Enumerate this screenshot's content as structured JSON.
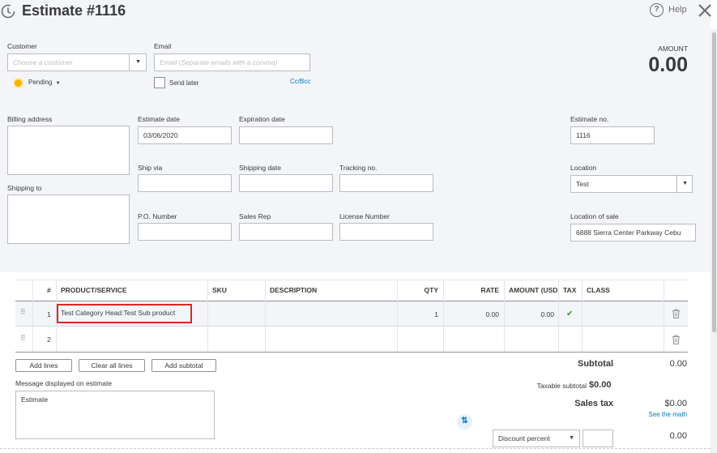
{
  "header": {
    "title": "Estimate #1116",
    "help": "Help"
  },
  "customer": {
    "label": "Customer",
    "placeholder": "Choose a customer"
  },
  "email": {
    "label": "Email",
    "placeholder": "Email (Separate emails with a comma)",
    "send_later": "Send later",
    "ccbcc": "Cc/Bcc"
  },
  "status": "Pending",
  "amount": {
    "label": "AMOUNT",
    "value": "0.00"
  },
  "billing_address": {
    "label": "Billing address"
  },
  "shipping_to": {
    "label": "Shipping to"
  },
  "estimate_date": {
    "label": "Estimate date",
    "value": "03/06/2020"
  },
  "expiration_date": {
    "label": "Expiration date"
  },
  "estimate_no": {
    "label": "Estimate no.",
    "value": "1116"
  },
  "ship_via": {
    "label": "Ship via"
  },
  "shipping_date": {
    "label": "Shipping date"
  },
  "tracking_no": {
    "label": "Tracking no."
  },
  "location": {
    "label": "Location",
    "value": "Test"
  },
  "po_number": {
    "label": "P.O. Number"
  },
  "sales_rep": {
    "label": "Sales Rep"
  },
  "license_number": {
    "label": "License Number"
  },
  "location_of_sale": {
    "label": "Location of sale",
    "value": "6888 Sierra Center Parkway Cebu"
  },
  "table": {
    "headers": {
      "num": "#",
      "product": "PRODUCT/SERVICE",
      "sku": "SKU",
      "description": "DESCRIPTION",
      "qty": "QTY",
      "rate": "RATE",
      "amount": "AMOUNT (USD",
      "tax": "TAX",
      "class": "CLASS"
    },
    "rows": [
      {
        "num": "1",
        "product": "Test Category Head:Test Sub product",
        "sku": "",
        "description": "",
        "qty": "1",
        "rate": "0.00",
        "amount": "0.00",
        "tax": "✔",
        "class": ""
      },
      {
        "num": "2",
        "product": "",
        "sku": "",
        "description": "",
        "qty": "",
        "rate": "",
        "amount": "",
        "tax": "",
        "class": ""
      }
    ]
  },
  "buttons": {
    "add_lines": "Add lines",
    "clear_all_lines": "Clear all lines",
    "add_subtotal": "Add subtotal"
  },
  "message": {
    "label": "Message displayed on estimate",
    "value": "Estimate"
  },
  "totals": {
    "subtotal_label": "Subtotal",
    "subtotal": "0.00",
    "taxable_label": "Taxable subtotal",
    "taxable": "$0.00",
    "sales_tax_label": "Sales tax",
    "sales_tax": "$0.00",
    "see_math": "See the math",
    "discount_type": "Discount percent",
    "discount_total": "0.00"
  },
  "colors": {
    "highlight": "#d52b1e",
    "link": "#0077c5",
    "check": "#2ca01c"
  }
}
